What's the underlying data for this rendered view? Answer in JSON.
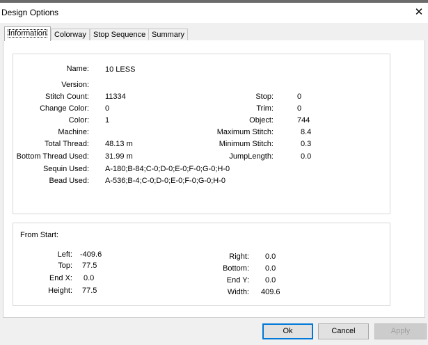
{
  "window": {
    "title": "Design Options",
    "close_glyph": "✕"
  },
  "tabs": [
    {
      "label": "Information",
      "active": true
    },
    {
      "label": "Colorway",
      "active": false
    },
    {
      "label": "Stop Sequence",
      "active": false
    },
    {
      "label": "Summary",
      "active": false
    }
  ],
  "info": {
    "name_label": "Name:",
    "name": "10 LESS",
    "version_label": "Version:",
    "version": "",
    "stitch_count_label": "Stitch Count:",
    "stitch_count": "11334",
    "change_color_label": "Change Color:",
    "change_color": "0",
    "color_label": "Color:",
    "color": "1",
    "machine_label": "Machine:",
    "machine": "",
    "total_thread_label": "Total Thread:",
    "total_thread": "48.13 m",
    "bottom_thread_label": "Bottom Thread Used:",
    "bottom_thread": "31.99 m",
    "sequin_label": "Sequin Used:",
    "sequin": "A-180;B-84;C-0;D-0;E-0;F-0;G-0;H-0",
    "bead_label": "Bead Used:",
    "bead": "A-536;B-4;C-0;D-0;E-0;F-0;G-0;H-0",
    "stop_label": "Stop:",
    "stop": "0",
    "trim_label": "Trim:",
    "trim": "0",
    "object_label": "Object:",
    "object": "744",
    "max_stitch_label": "Maximum Stitch:",
    "max_stitch": "8.4",
    "min_stitch_label": "Minimum Stitch:",
    "min_stitch": "0.3",
    "jump_length_label": "JumpLength:",
    "jump_length": "0.0"
  },
  "from_start": {
    "heading": "From Start:",
    "left_label": "Left:",
    "left": "-409.6",
    "top_label": "Top:",
    "top": "77.5",
    "end_x_label": "End X:",
    "end_x": "0.0",
    "height_label": "Height:",
    "height": "77.5",
    "right_label": "Right:",
    "right": "0.0",
    "bottom_label": "Bottom:",
    "bottom": "0.0",
    "end_y_label": "End Y:",
    "end_y": "0.0",
    "width_label": "Width:",
    "width": "409.6"
  },
  "buttons": {
    "ok": "Ok",
    "cancel": "Cancel",
    "apply": "Apply"
  }
}
